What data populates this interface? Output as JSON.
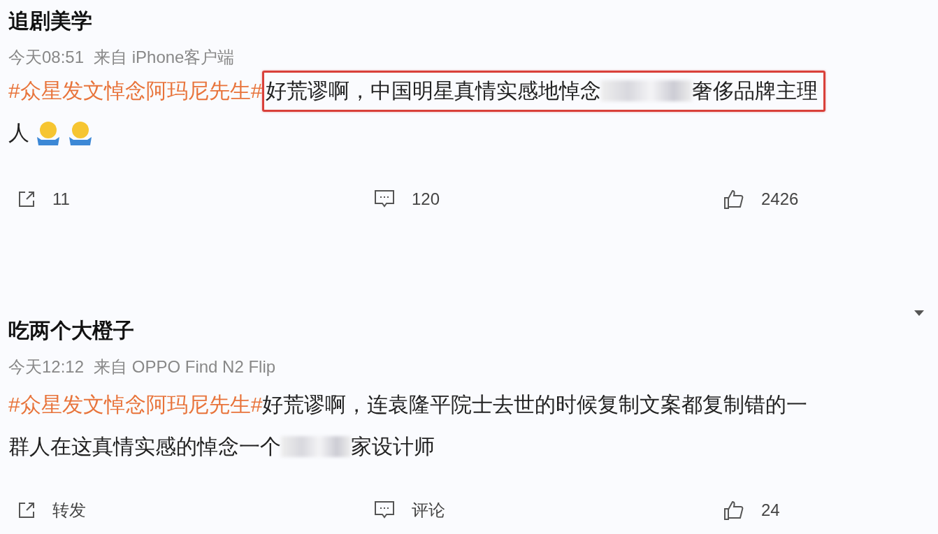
{
  "posts": [
    {
      "author": "追剧美学",
      "time": "今天08:51",
      "source": "来自 iPhone客户端",
      "has_menu": false,
      "lines": [
        [
          {
            "kind": "topic",
            "text": "#众星发文悼念阿玛尼先生#"
          },
          {
            "kind": "highlight",
            "parts": [
              {
                "kind": "text",
                "text": "好荒谬啊，中国明星真情实感地悼念"
              },
              {
                "kind": "redacted"
              },
              {
                "kind": "text",
                "text": "奢侈品牌主理"
              }
            ]
          }
        ],
        [
          {
            "kind": "text",
            "text": "人"
          },
          {
            "kind": "emoji"
          },
          {
            "kind": "emoji"
          }
        ]
      ],
      "actions": [
        {
          "kind": "share",
          "label": "11"
        },
        {
          "kind": "comment",
          "label": "120"
        },
        {
          "kind": "like",
          "label": "2426"
        }
      ]
    },
    {
      "author": "吃两个大橙子",
      "time": "今天12:12",
      "source": "来自 OPPO Find N2 Flip",
      "has_menu": true,
      "lines": [
        [
          {
            "kind": "topic",
            "text": "#众星发文悼念阿玛尼先生#"
          },
          {
            "kind": "text",
            "text": "好荒谬啊，连袁隆平院士去世的时候复制文案都复制错的一"
          }
        ],
        [
          {
            "kind": "text",
            "text": "群人在这真情实感的悼念一个"
          },
          {
            "kind": "redacted"
          },
          {
            "kind": "text",
            "text": "家设计师"
          }
        ]
      ],
      "actions": [
        {
          "kind": "share",
          "label": "转发"
        },
        {
          "kind": "comment",
          "label": "评论"
        },
        {
          "kind": "like",
          "label": "24"
        }
      ]
    }
  ]
}
